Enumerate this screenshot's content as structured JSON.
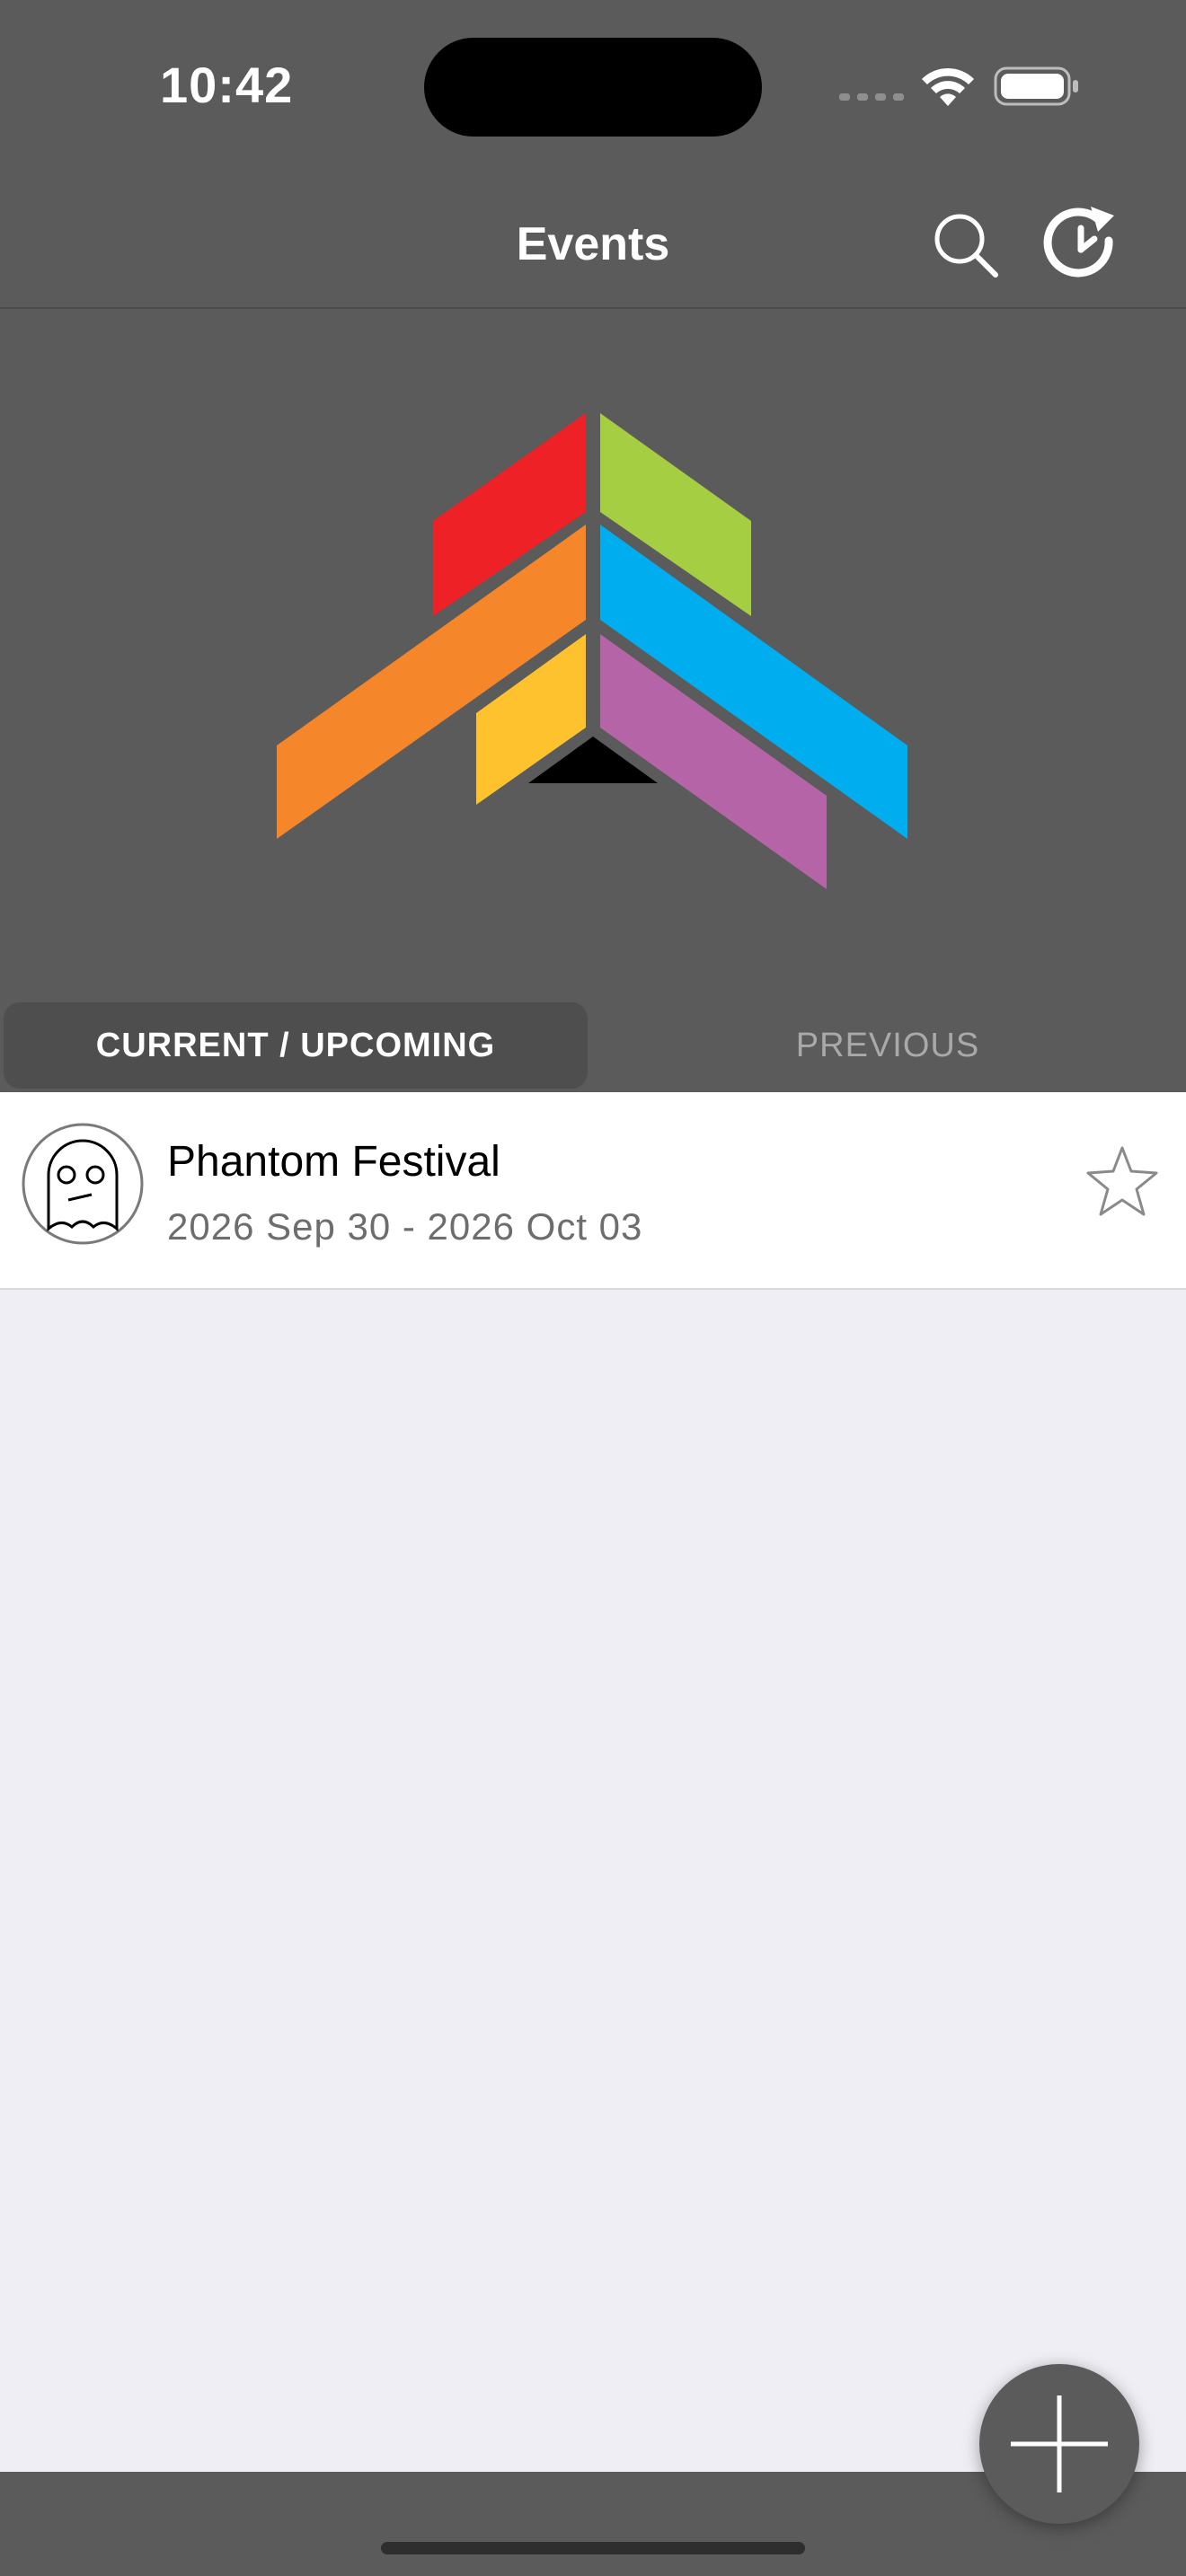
{
  "status_bar": {
    "time": "10:42"
  },
  "nav": {
    "title": "Events",
    "search_icon": "search-icon",
    "history_icon": "refresh-clock-icon"
  },
  "tabs": [
    {
      "label": "CURRENT / UPCOMING",
      "selected": true
    },
    {
      "label": "PREVIOUS",
      "selected": false
    }
  ],
  "events": [
    {
      "name": "Phantom Festival",
      "dates": "2026 Sep 30 - 2026 Oct 03",
      "avatar_icon": "ghost-icon",
      "favorite_icon": "star-outline-icon",
      "favorited": false
    }
  ],
  "fab": {
    "icon": "plus-icon"
  },
  "colors": {
    "bar_background": "#5b5b5b",
    "list_background": "#efeef4",
    "logo_red": "#ee2127",
    "logo_green": "#a6ce42",
    "logo_orange": "#f6862a",
    "logo_blue": "#00aeef",
    "logo_yellow": "#fdc22d",
    "logo_purple": "#b565a7"
  }
}
